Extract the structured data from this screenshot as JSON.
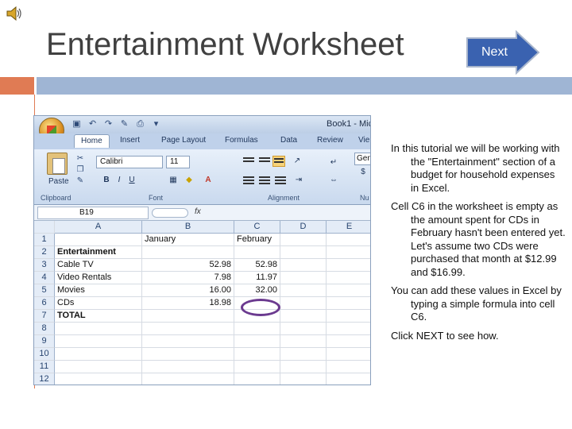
{
  "slide": {
    "title": "Entertainment Worksheet",
    "next_label": "Next"
  },
  "excel": {
    "book_name": "Book1 - Mic",
    "tabs": [
      "Home",
      "Insert",
      "Page Layout",
      "Formulas",
      "Data",
      "Review",
      "Vie"
    ],
    "ribbon": {
      "paste_label": "Paste",
      "group_clipboard": "Clipboard",
      "group_font": "Font",
      "group_alignment": "Alignment",
      "group_number": "Nu",
      "font_name": "Calibri",
      "font_size": "11",
      "number_format": "Gen",
      "bold": "B",
      "italic": "I",
      "underline": "U"
    },
    "name_box": "B19",
    "fx": "fx",
    "columns": [
      "A",
      "B",
      "C",
      "D",
      "E"
    ],
    "rows": [
      {
        "num": "1",
        "a": "",
        "b": "January",
        "c": "February"
      },
      {
        "num": "2",
        "a": "Entertainment",
        "b": "",
        "c": ""
      },
      {
        "num": "3",
        "a": "Cable TV",
        "b": "52.98",
        "c": "52.98"
      },
      {
        "num": "4",
        "a": "Video Rentals",
        "b": "7.98",
        "c": "11.97"
      },
      {
        "num": "5",
        "a": "Movies",
        "b": "16.00",
        "c": "32.00"
      },
      {
        "num": "6",
        "a": "CDs",
        "b": "18.98",
        "c": ""
      },
      {
        "num": "7",
        "a": "TOTAL",
        "b": "",
        "c": ""
      },
      {
        "num": "8",
        "a": "",
        "b": "",
        "c": ""
      },
      {
        "num": "9",
        "a": "",
        "b": "",
        "c": ""
      },
      {
        "num": "10",
        "a": "",
        "b": "",
        "c": ""
      },
      {
        "num": "11",
        "a": "",
        "b": "",
        "c": ""
      },
      {
        "num": "12",
        "a": "",
        "b": "",
        "c": ""
      }
    ]
  },
  "panel": {
    "p1": "In this tutorial we will be working with the \"Entertainment\" section of a budget for household expenses in Excel.",
    "p2": "Cell C6 in the worksheet is empty as the amount spent for CDs in February hasn't been entered yet. Let's assume two CDs were purchased that month at $12.99 and $16.99.",
    "p3": "You can add these values in Excel by typing a simple formula into cell C6.",
    "p4": "Click NEXT to see how."
  },
  "colors": {
    "accent_orange": "#e07b54",
    "accent_blue": "#9fb5d4",
    "title_gray": "#404040",
    "next_arrow": "#3a62b0",
    "circle_purple": "#6b3a8f"
  },
  "icons": [
    "speaker-icon",
    "next-arrow-icon",
    "office-button-icon"
  ]
}
